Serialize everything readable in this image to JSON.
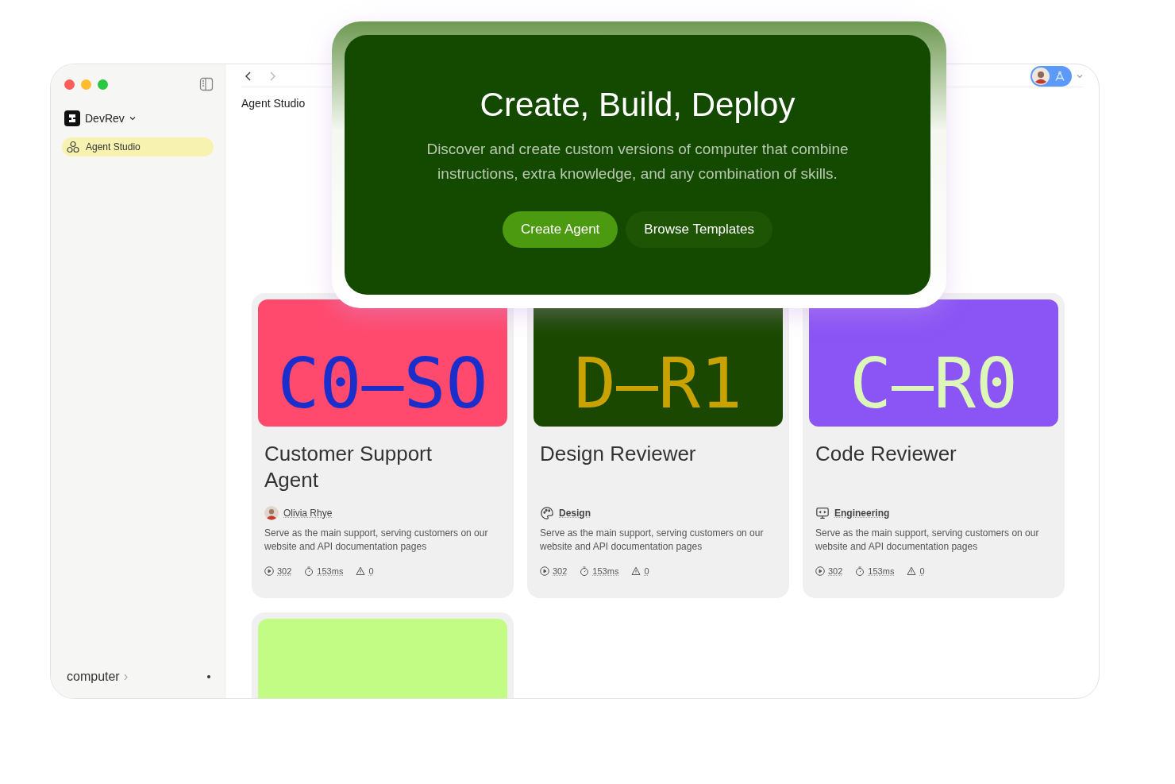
{
  "sidebar": {
    "workspace": "DevRev",
    "items": [
      {
        "label": "Agent Studio",
        "selected": true
      }
    ],
    "footer": "computer"
  },
  "breadcrumb": "Agent Studio",
  "hero": {
    "title": "Create, Build, Deploy",
    "subtitle": "Discover and create custom versions of computer that combine instructions, extra knowledge, and any combination of skills.",
    "buttons": [
      {
        "label": "Create Agent",
        "kind": "primary"
      },
      {
        "label": "Browse Templates",
        "kind": "secondary"
      }
    ]
  },
  "agents": [
    {
      "kind": "person",
      "code": {
        "text": "C0—SO",
        "color": "#1a2ecc"
      },
      "color": "#ff4a6e",
      "title": "Customer Support Agent",
      "owner": "Olivia Rhye",
      "description": "Serve as the main support, serving customers on our website and API documentation pages",
      "runs": "302",
      "latency": "153ms",
      "errors": "0"
    },
    {
      "kind": "design",
      "code": {
        "text": "D—R1",
        "color": "#c9a200"
      },
      "color": "#1a4800",
      "title": "Design Reviewer",
      "owner": "Design",
      "description": "Serve as the main support, serving customers on our website and API documentation pages",
      "runs": "302",
      "latency": "153ms",
      "errors": "0"
    },
    {
      "kind": "engineering",
      "code": {
        "text": "C—R0",
        "color": "#dcf7b8"
      },
      "color": "#8b55f5",
      "title": "Code Reviewer",
      "owner": "Engineering",
      "description": "Serve as the main support, serving customers on our website and API documentation pages",
      "runs": "302",
      "latency": "153ms",
      "errors": "0"
    },
    {
      "color": "#c3fc84"
    }
  ]
}
